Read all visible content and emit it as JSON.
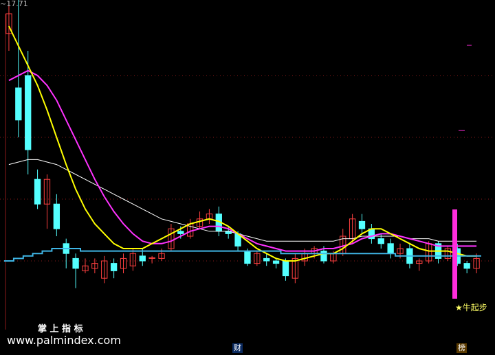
{
  "price_label": "17.71",
  "signal_label": "★牛起步",
  "watermark_title": "掌 上 指 标",
  "watermark_url": "www.palmindex.com",
  "marker_left": "财",
  "marker_right": "榜",
  "colors": {
    "background": "#000000",
    "up_candle": "#ff4040",
    "down_candle": "#54ffff",
    "ma_fast": "#ffff00",
    "ma_mid": "#ff32ff",
    "ma_slow": "#ffffff",
    "support": "#3fb6e6",
    "signal_bar": "#ff2ddc",
    "grid": "#8b1a1a"
  },
  "chart_data": {
    "type": "candlestick",
    "y_top_label": 17.71,
    "candles": [
      {
        "o": 97,
        "c": 105,
        "h": 110,
        "l": 90
      },
      {
        "o": 75,
        "c": 62,
        "h": 115,
        "l": 55
      },
      {
        "o": 80,
        "c": 50,
        "h": 90,
        "l": 40
      },
      {
        "o": 38,
        "c": 28,
        "h": 42,
        "l": 26
      },
      {
        "o": 28,
        "c": 38,
        "h": 40,
        "l": 18
      },
      {
        "o": 28,
        "c": 18,
        "h": 32,
        "l": 15
      },
      {
        "o": 12,
        "c": 8,
        "h": 14,
        "l": 2
      },
      {
        "o": 6,
        "c": 2,
        "h": 8,
        "l": -6
      },
      {
        "o": 1,
        "c": 3,
        "h": 6,
        "l": 0
      },
      {
        "o": 2,
        "c": 4,
        "h": 6,
        "l": 0
      },
      {
        "o": -2,
        "c": 5,
        "h": 7,
        "l": -4
      },
      {
        "o": 4,
        "c": 1,
        "h": 6,
        "l": -2
      },
      {
        "o": 2,
        "c": 6,
        "h": 8,
        "l": 0
      },
      {
        "o": 3,
        "c": 8,
        "h": 10,
        "l": 1
      },
      {
        "o": 7,
        "c": 5,
        "h": 10,
        "l": 3
      },
      {
        "o": 6,
        "c": 6.3,
        "h": 7,
        "l": 4
      },
      {
        "o": 6,
        "c": 8,
        "h": 10,
        "l": 5
      },
      {
        "o": 10,
        "c": 18,
        "h": 20,
        "l": 9
      },
      {
        "o": 17,
        "c": 16,
        "h": 19,
        "l": 14
      },
      {
        "o": 15,
        "c": 20,
        "h": 22,
        "l": 14
      },
      {
        "o": 19,
        "c": 22,
        "h": 25,
        "l": 18
      },
      {
        "o": 22,
        "c": 24,
        "h": 26,
        "l": 20
      },
      {
        "o": 24,
        "c": 17,
        "h": 27,
        "l": 15
      },
      {
        "o": 17,
        "c": 16,
        "h": 19,
        "l": 14
      },
      {
        "o": 16,
        "c": 11,
        "h": 17,
        "l": 9
      },
      {
        "o": 9,
        "c": 4,
        "h": 10,
        "l": 3
      },
      {
        "o": 4,
        "c": 8,
        "h": 9,
        "l": 3
      },
      {
        "o": 6,
        "c": 5,
        "h": 8,
        "l": 3
      },
      {
        "o": 5,
        "c": 4,
        "h": 6,
        "l": 2
      },
      {
        "o": 5,
        "c": -1,
        "h": 6,
        "l": -3
      },
      {
        "o": -2,
        "c": 6,
        "h": 8,
        "l": -4
      },
      {
        "o": 5,
        "c": 8,
        "h": 10,
        "l": 3
      },
      {
        "o": 8,
        "c": 10,
        "h": 11,
        "l": 6
      },
      {
        "o": 9,
        "c": 5,
        "h": 11,
        "l": 4
      },
      {
        "o": 5,
        "c": 8,
        "h": 9,
        "l": 4
      },
      {
        "o": 8,
        "c": 15,
        "h": 18,
        "l": 7
      },
      {
        "o": 14,
        "c": 22,
        "h": 24,
        "l": 12
      },
      {
        "o": 21,
        "c": 18,
        "h": 24,
        "l": 16
      },
      {
        "o": 18,
        "c": 14,
        "h": 20,
        "l": 12
      },
      {
        "o": 14,
        "c": 12,
        "h": 16,
        "l": 10
      },
      {
        "o": 12,
        "c": 8,
        "h": 14,
        "l": 6
      },
      {
        "o": 8,
        "c": 10,
        "h": 12,
        "l": 6
      },
      {
        "o": 10,
        "c": 4,
        "h": 12,
        "l": 2
      },
      {
        "o": 4,
        "c": 5,
        "h": 6,
        "l": 1
      },
      {
        "o": 5,
        "c": 12,
        "h": 13,
        "l": 4
      },
      {
        "o": 12,
        "c": 6,
        "h": 13,
        "l": 4
      },
      {
        "o": 6,
        "c": 10,
        "h": 11,
        "l": 5
      },
      {
        "o": 10,
        "c": 4,
        "h": 12,
        "l": 3
      },
      {
        "o": 4,
        "c": 2,
        "h": 5,
        "l": 0
      },
      {
        "o": 2,
        "c": 6,
        "h": 8,
        "l": 0
      }
    ],
    "ma_fast": [
      100,
      92,
      84,
      76,
      66,
      55,
      44,
      34,
      26,
      20,
      16,
      12,
      10,
      10,
      10,
      12,
      14,
      16,
      18,
      20,
      21,
      22,
      21,
      19,
      16,
      13,
      10,
      8,
      6,
      5,
      5,
      6,
      7,
      8,
      8,
      10,
      13,
      16,
      18,
      18,
      16,
      14,
      12,
      10,
      9,
      9,
      9,
      8,
      7,
      7
    ],
    "ma_mid": [
      78,
      80,
      82,
      80,
      76,
      70,
      62,
      54,
      46,
      38,
      31,
      25,
      20,
      16,
      13,
      12,
      12,
      13,
      15,
      17,
      18,
      19,
      19,
      18,
      16,
      14,
      12,
      11,
      10,
      9,
      9,
      9,
      9,
      10,
      10,
      11,
      12,
      14,
      15,
      16,
      16,
      15,
      14,
      13,
      12,
      11,
      11,
      11,
      11,
      11
    ],
    "ma_slow": [
      44,
      45,
      46,
      46,
      45,
      44,
      42,
      40,
      38,
      36,
      34,
      32,
      30,
      28,
      26,
      24,
      22,
      21,
      20,
      19,
      18,
      17,
      17,
      17,
      16,
      15,
      14,
      13,
      13,
      13,
      13,
      13,
      13,
      13,
      13,
      14,
      14,
      15,
      15,
      15,
      15,
      15,
      14,
      14,
      14,
      13,
      13,
      13,
      13,
      13
    ],
    "support": [
      5,
      6,
      7,
      8,
      9,
      10,
      10,
      10,
      9,
      9,
      9,
      9,
      9,
      9,
      9,
      9,
      9,
      9,
      9,
      9,
      9,
      9,
      9,
      9,
      9,
      9,
      9,
      9,
      9,
      8,
      8,
      8,
      8,
      8,
      8,
      8,
      8,
      8,
      8,
      8,
      8,
      7,
      7,
      7,
      7,
      7,
      7,
      7,
      7,
      7
    ],
    "ylim": [
      -20,
      105
    ]
  }
}
